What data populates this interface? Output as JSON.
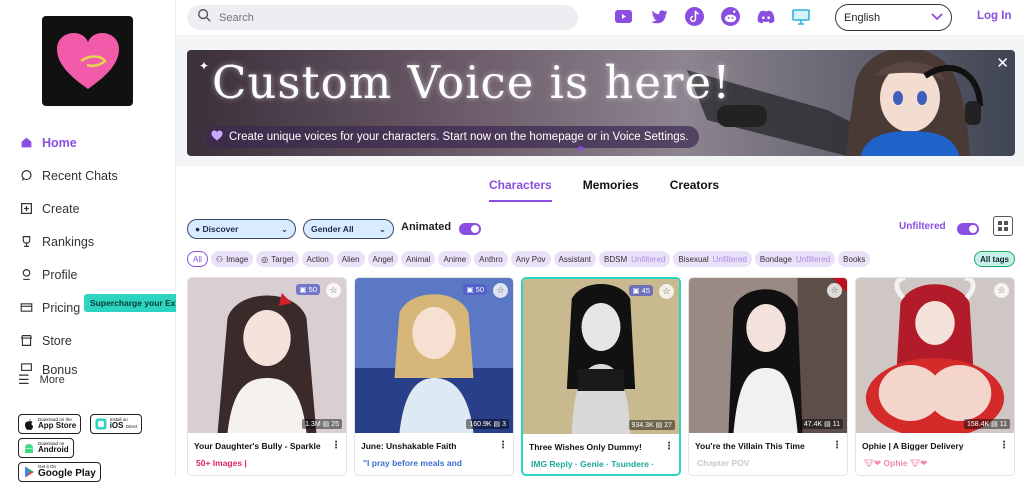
{
  "sidebar": {
    "items": [
      {
        "label": "Home",
        "icon": "home-icon"
      },
      {
        "label": "Recent Chats",
        "icon": "chat-icon"
      },
      {
        "label": "Create",
        "icon": "plus-square-icon"
      },
      {
        "label": "Rankings",
        "icon": "trophy-icon"
      },
      {
        "label": "Profile",
        "icon": "profile-icon"
      },
      {
        "label": "Pricing",
        "icon": "credit-card-icon"
      },
      {
        "label": "Store",
        "icon": "store-icon"
      },
      {
        "label": "Bonus",
        "icon": "gift-icon"
      }
    ],
    "tooltip": "Supercharge your Experience",
    "more_label": "More",
    "badges": [
      {
        "small": "Download on the",
        "big": "App Store"
      },
      {
        "small": "Install on",
        "big": "iOS",
        "suffix": "Direct"
      },
      {
        "small": "Download on",
        "big": "Android"
      },
      {
        "small": "Get it On",
        "big": "Google Play"
      }
    ]
  },
  "topbar": {
    "search_placeholder": "Search",
    "socials": [
      "youtube-icon",
      "twitter-icon",
      "tiktok-icon",
      "reddit-icon",
      "discord-icon",
      "monitor-icon"
    ],
    "language": "English",
    "login": "Log In"
  },
  "banner": {
    "title": "Custom Voice is here!",
    "subtitle": "Create unique voices for your characters. Start now on the homepage or in Voice Settings."
  },
  "tabs": [
    "Characters",
    "Memories",
    "Creators"
  ],
  "filters": {
    "discover": "Discover",
    "gender": "Gender All",
    "animated_label": "Animated",
    "unfiltered_label": "Unfiltered"
  },
  "tags": [
    {
      "label": "All"
    },
    {
      "label": "Image"
    },
    {
      "label": "Target"
    },
    {
      "label": "Action"
    },
    {
      "label": "Alien"
    },
    {
      "label": "Angel"
    },
    {
      "label": "Animal"
    },
    {
      "label": "Anime"
    },
    {
      "label": "Anthro"
    },
    {
      "label": "Any Pov"
    },
    {
      "label": "Assistant"
    },
    {
      "label": "BDSM",
      "unf": "Unfiltered"
    },
    {
      "label": "Bisexual",
      "unf": "Unfiltered"
    },
    {
      "label": "Bondage",
      "unf": "Unfiltered"
    },
    {
      "label": "Books"
    }
  ],
  "all_tags_label": "All tags",
  "cards": [
    {
      "count_tl": "50",
      "views": "1.3M",
      "msgs": "25",
      "title": "Your Daughter's Bully - Sparkle",
      "desc": "50+ Images |",
      "desc_color": "#e0245e"
    },
    {
      "count_tl": "50",
      "views": "160.9K",
      "msgs": "3",
      "title": "June: Unshakable Faith",
      "desc": "\"I pray before meals and",
      "desc_color": "#3b6fd0"
    },
    {
      "count_tl": "45",
      "views": "934.3K",
      "msgs": "27",
      "title": "Three Wishes Only Dummy!",
      "desc": "IMG Reply · Genie · Tsundere ·",
      "desc_color": "#1aa89a"
    },
    {
      "count_tl": "",
      "views": "47.4K",
      "msgs": "11",
      "title": "You're the Villain This Time",
      "desc": "Chapter POV",
      "desc_color": "#c9c9c9"
    },
    {
      "count_tl": "",
      "views": "158.4K",
      "msgs": "11",
      "title": "Ophie | A Bigger Delivery",
      "desc": "Ophie",
      "desc_color": "#f08ab0"
    }
  ]
}
